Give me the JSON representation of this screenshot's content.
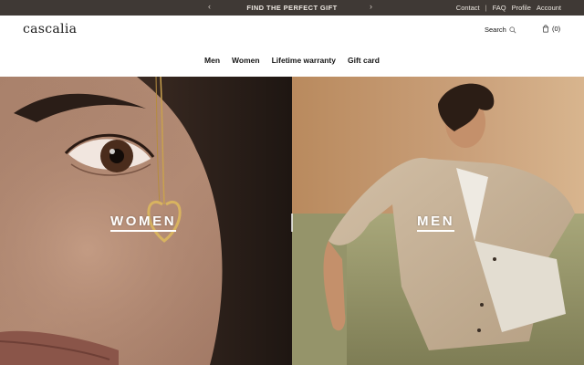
{
  "topbar": {
    "prev_arrow": "‹",
    "next_arrow": "›",
    "promo": "FIND THE PERFECT GIFT",
    "links": [
      "Contact",
      "FAQ",
      "Profile",
      "Account"
    ],
    "separator": "|"
  },
  "header": {
    "logo": "cascalia",
    "search_label": "Search",
    "cart_label": "(0)"
  },
  "nav": {
    "items": [
      "Men",
      "Women",
      "Lifetime warranty",
      "Gift card"
    ]
  },
  "hero": {
    "women_label": "WOMEN",
    "men_label": "MEN"
  },
  "colors": {
    "topbar_bg": "#3f3935",
    "text": "#111111"
  }
}
